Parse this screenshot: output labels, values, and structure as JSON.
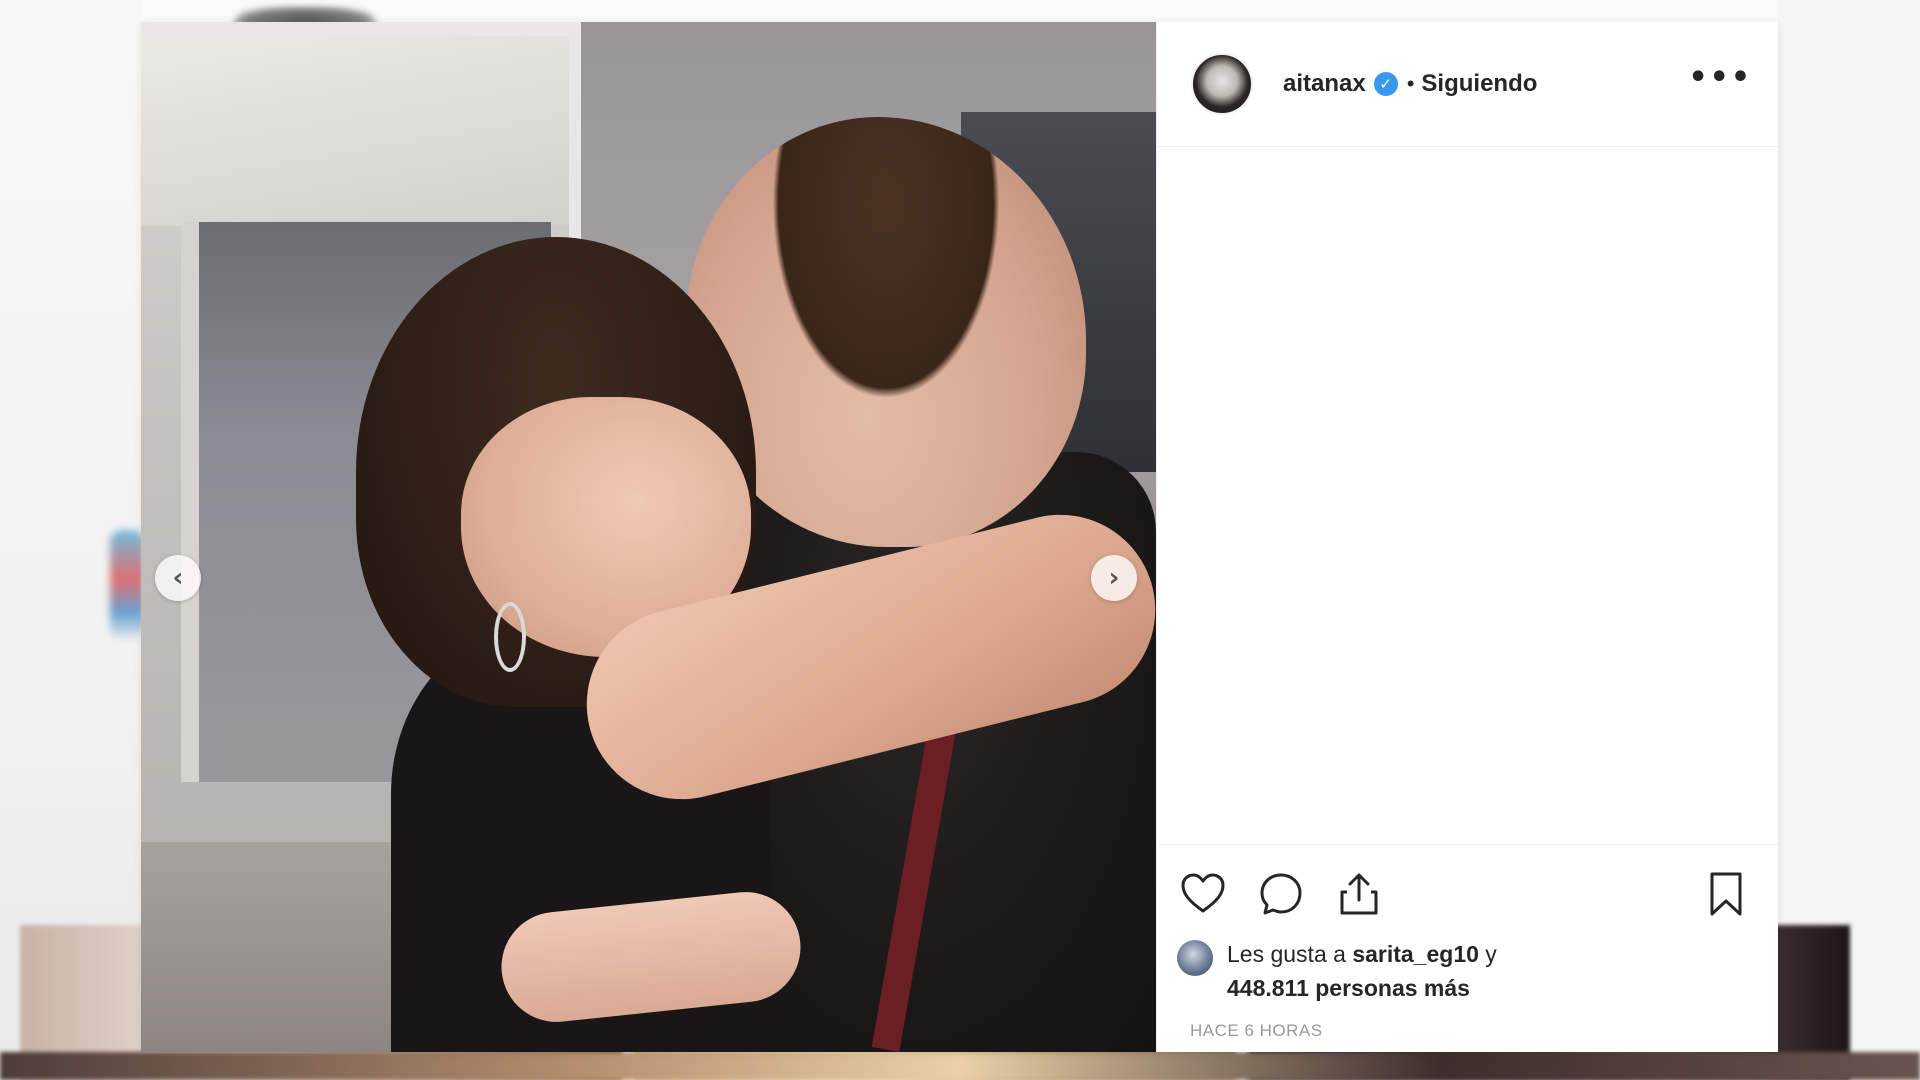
{
  "post": {
    "username": "aitanax",
    "verified_badge": "✓",
    "separator": "•",
    "follow_status": "Siguiendo",
    "more_label": "•••",
    "likes": {
      "prefix": "Les gusta a",
      "liker": "sarita_eg10",
      "conjunction": "y",
      "count_text": "448.811 personas más"
    },
    "timestamp": "HACE 6 HORAS"
  },
  "carousel": {
    "prev_glyph": "‹",
    "next_glyph": "›"
  },
  "icons": {
    "like": "heart-icon",
    "comment": "comment-icon",
    "share": "share-icon",
    "save": "bookmark-icon",
    "verified": "verified-badge-icon",
    "more": "more-options-icon"
  },
  "colors": {
    "verified": "#3897f0",
    "text": "#262626",
    "muted": "#999999",
    "border": "#efefef"
  }
}
